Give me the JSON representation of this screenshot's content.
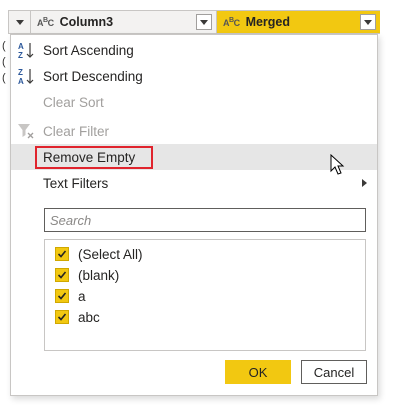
{
  "header": {
    "column3": {
      "type_glyph": "ABC",
      "label": "Column3"
    },
    "merged": {
      "type_glyph": "ABC",
      "label": "Merged"
    }
  },
  "background_chars": [
    "(",
    "(",
    "("
  ],
  "menu": {
    "items": [
      {
        "label": "Sort Ascending",
        "icon": "sort-ascending-icon",
        "disabled": false
      },
      {
        "label": "Sort Descending",
        "icon": "sort-descending-icon",
        "disabled": false
      },
      {
        "label": "Clear Sort",
        "icon": "",
        "disabled": true
      },
      {
        "label": "Clear Filter",
        "icon": "clear-filter-icon",
        "disabled": true
      },
      {
        "label": "Remove Empty",
        "icon": "",
        "disabled": false,
        "highlighted": true
      },
      {
        "label": "Text Filters",
        "icon": "",
        "disabled": false,
        "submenu": true
      }
    ]
  },
  "search": {
    "placeholder": "Search",
    "value": ""
  },
  "filter_list": {
    "items": [
      {
        "label": "(Select All)",
        "checked": true
      },
      {
        "label": "(blank)",
        "checked": true
      },
      {
        "label": "a",
        "checked": true
      },
      {
        "label": "abc",
        "checked": true
      }
    ]
  },
  "buttons": {
    "ok": "OK",
    "cancel": "Cancel"
  },
  "colors": {
    "accent": "#f2c811",
    "highlight_border": "#e0242d",
    "hover_row": "#e6e6e6",
    "disabled_text": "#a19f9d"
  }
}
